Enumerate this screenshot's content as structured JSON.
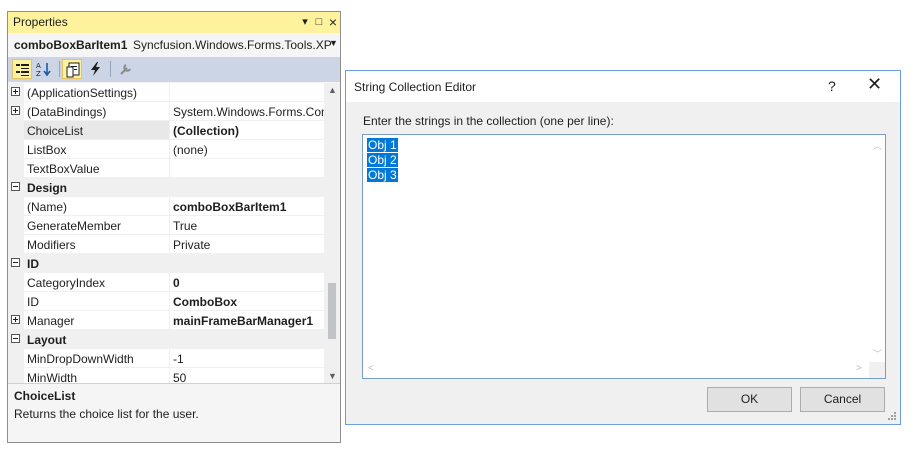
{
  "properties_panel": {
    "title": "Properties",
    "pin_icon": "▾",
    "maximize_icon": "□",
    "close_icon": "×",
    "object_name": "comboBoxBarItem1",
    "object_type": "Syncfusion.Windows.Forms.Tools.XP",
    "dropdown_icon": "▼",
    "toolbar": [
      "categorized-icon",
      "alphabetical-icon",
      "properties-icon",
      "events-icon",
      "property-pages-icon"
    ],
    "rows": [
      {
        "name": "(ApplicationSettings)",
        "value": ""
      },
      {
        "name": "(DataBindings)",
        "value": "System.Windows.Forms.Con"
      },
      {
        "name": "ChoiceList",
        "value": "(Collection)"
      },
      {
        "name": "ListBox",
        "value": "(none)"
      },
      {
        "name": "TextBoxValue",
        "value": ""
      },
      {
        "name": "Design",
        "value": ""
      },
      {
        "name": "(Name)",
        "value": "comboBoxBarItem1"
      },
      {
        "name": "GenerateMember",
        "value": "True"
      },
      {
        "name": "Modifiers",
        "value": "Private"
      },
      {
        "name": "ID",
        "value": ""
      },
      {
        "name": "CategoryIndex",
        "value": "0"
      },
      {
        "name": "ID",
        "value": "ComboBox"
      },
      {
        "name": "Manager",
        "value": "mainFrameBarManager1"
      },
      {
        "name": "Layout",
        "value": ""
      },
      {
        "name": "MinDropDownWidth",
        "value": "-1"
      },
      {
        "name": "MinWidth",
        "value": "50"
      }
    ],
    "scroll_up": "▲",
    "scroll_down": "▼",
    "description_title": "ChoiceList",
    "description_text": "Returns the choice list for the user."
  },
  "dialog": {
    "title": "String Collection Editor",
    "help": "?",
    "close": "✕",
    "label": "Enter the strings in the collection (one per line):",
    "lines": [
      "Obj 1",
      "Obj 2",
      "Obj 3"
    ],
    "scroll_up": "︿",
    "scroll_down": "﹀",
    "scroll_left": "<",
    "scroll_right": ">",
    "ok_label": "OK",
    "cancel_label": "Cancel"
  }
}
